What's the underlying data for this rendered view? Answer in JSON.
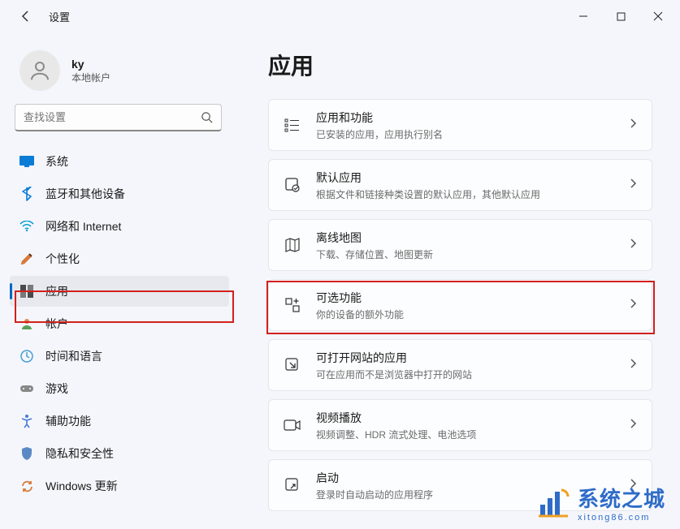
{
  "window": {
    "title": "设置"
  },
  "user": {
    "name": "ky",
    "subtitle": "本地帐户"
  },
  "search": {
    "placeholder": "查找设置"
  },
  "nav": [
    {
      "key": "system",
      "label": "系统"
    },
    {
      "key": "bluetooth",
      "label": "蓝牙和其他设备"
    },
    {
      "key": "network",
      "label": "网络和 Internet"
    },
    {
      "key": "personalization",
      "label": "个性化"
    },
    {
      "key": "apps",
      "label": "应用"
    },
    {
      "key": "accounts",
      "label": "帐户"
    },
    {
      "key": "time",
      "label": "时间和语言"
    },
    {
      "key": "gaming",
      "label": "游戏"
    },
    {
      "key": "accessibility",
      "label": "辅助功能"
    },
    {
      "key": "privacy",
      "label": "隐私和安全性"
    },
    {
      "key": "update",
      "label": "Windows 更新"
    }
  ],
  "page": {
    "title": "应用"
  },
  "cards": [
    {
      "key": "apps-features",
      "title": "应用和功能",
      "sub": "已安装的应用，应用执行别名"
    },
    {
      "key": "default-apps",
      "title": "默认应用",
      "sub": "根据文件和链接种类设置的默认应用，其他默认应用"
    },
    {
      "key": "offline-maps",
      "title": "离线地图",
      "sub": "下载、存储位置、地图更新"
    },
    {
      "key": "optional-features",
      "title": "可选功能",
      "sub": "你的设备的额外功能"
    },
    {
      "key": "website-apps",
      "title": "可打开网站的应用",
      "sub": "可在应用而不是浏览器中打开的网站"
    },
    {
      "key": "video-playback",
      "title": "视频播放",
      "sub": "视频调整、HDR 流式处理、电池选项"
    },
    {
      "key": "startup",
      "title": "启动",
      "sub": "登录时自动启动的应用程序"
    }
  ],
  "brand": {
    "main": "系统之城",
    "sub": "xitong86.com"
  }
}
